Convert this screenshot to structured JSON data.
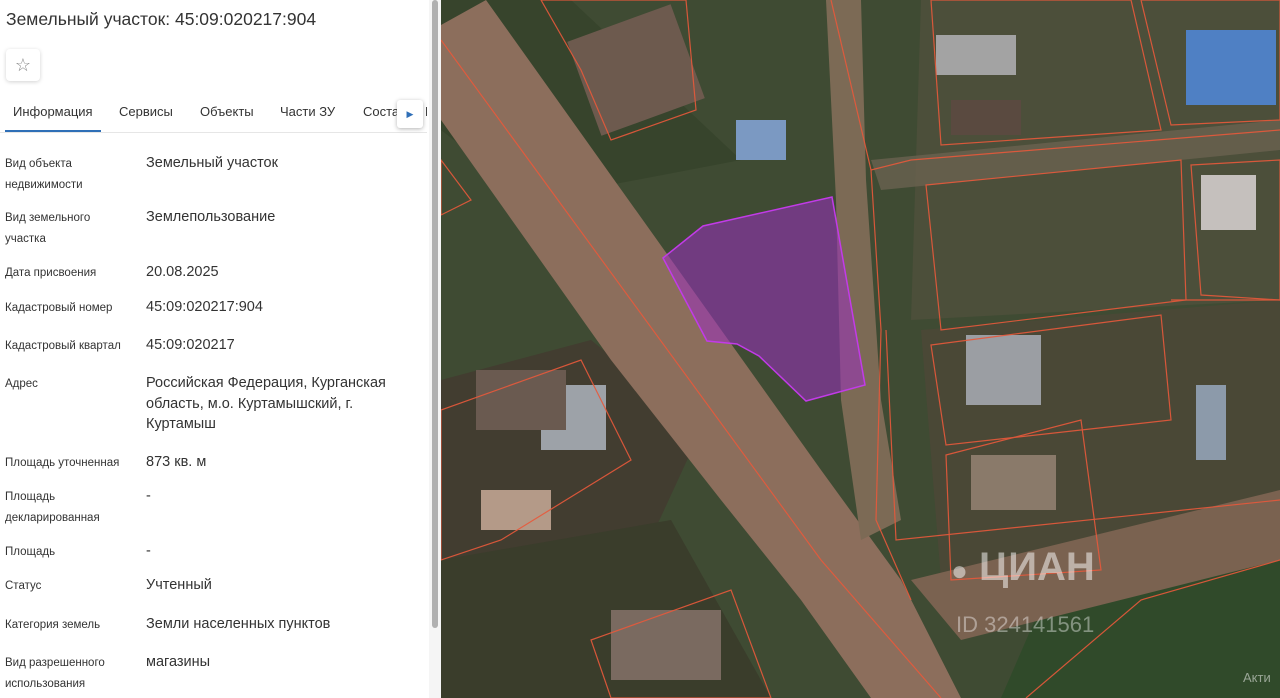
{
  "title": "Земельный участок: 45:09:020217:904",
  "tabs": [
    {
      "label": "Информация",
      "active": true
    },
    {
      "label": "Сервисы",
      "active": false
    },
    {
      "label": "Объекты",
      "active": false
    },
    {
      "label": "Части ЗУ",
      "active": false
    },
    {
      "label": "Соста",
      "active": false
    },
    {
      "label": "Г",
      "active": false
    }
  ],
  "properties": [
    {
      "label": "Вид объекта недвижимости",
      "value": "Земельный участок"
    },
    {
      "label": "Вид земельного участка",
      "value": "Землепользование"
    },
    {
      "label": "Дата присвоения",
      "value": "20.08.2025"
    },
    {
      "label": "Кадастровый номер",
      "value": "45:09:020217:904"
    },
    {
      "label": "Кадастровый квартал",
      "value": "45:09:020217"
    },
    {
      "label": "Адрес",
      "value": "Российская Федерация, Курганская область, м.о. Куртамышский, г. Куртамыш"
    },
    {
      "label": "Площадь уточненная",
      "value": "873 кв. м"
    },
    {
      "label": "Площадь декларированная",
      "value": "-"
    },
    {
      "label": "Площадь",
      "value": "-"
    },
    {
      "label": "Статус",
      "value": "Учтенный"
    },
    {
      "label": "Категория земель",
      "value": "Земли населенных пунктов"
    },
    {
      "label": "Вид разрешенного использования",
      "value": "магазины"
    }
  ],
  "watermark": {
    "brand": "ЦИАН",
    "id": "ID 324141561",
    "corner": "Акти"
  },
  "colors": {
    "accent": "#2f6fb7",
    "parcel": "#9a2fc0",
    "boundary": "#e8593b"
  },
  "icons": {
    "favorite": "star-outline-icon",
    "next": "chevron-right-icon"
  }
}
